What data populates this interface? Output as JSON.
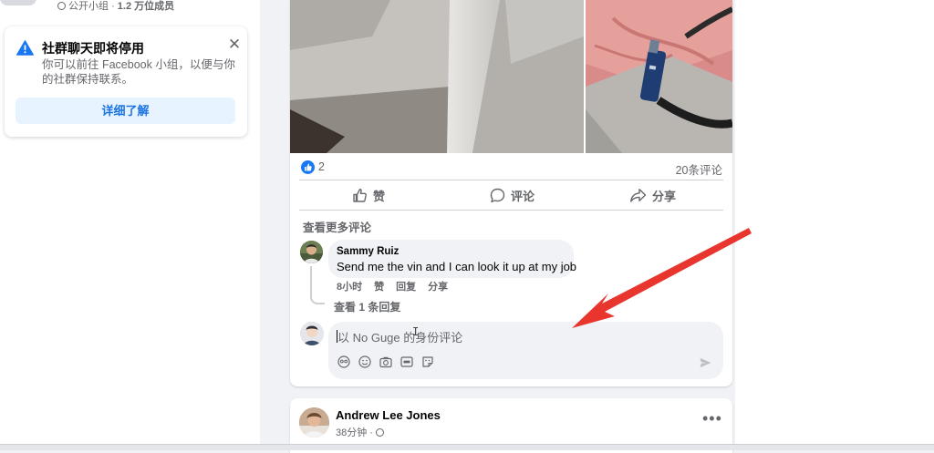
{
  "sidebar": {
    "group_meta_prefix": "公开小组 · ",
    "group_meta_count": "1.2 万位成员"
  },
  "notice": {
    "title": "社群聊天即将停用",
    "body": "你可以前往 Facebook 小组，以便与你的社群保持联系。",
    "close_glyph": "✕",
    "button_label": "详细了解"
  },
  "post": {
    "reaction_count": "2",
    "comment_count": "20条评论",
    "actions": {
      "like": "赞",
      "comment": "评论",
      "share": "分享"
    },
    "view_more_comments": "查看更多评论",
    "comment": {
      "author": "Sammy Ruiz",
      "text": "Send me the vin and I can look it up at my job",
      "time": "8小时",
      "like": "赞",
      "reply": "回复",
      "share": "分享"
    },
    "view_replies": "查看 1 条回复",
    "composer": {
      "placeholder": "以 No Guge 的身份评论",
      "tools": [
        "avatar-sticker-icon",
        "emoji-icon",
        "camera-icon",
        "gif-icon",
        "sticker-icon"
      ]
    }
  },
  "next_post": {
    "author": "Andrew Lee Jones",
    "time": "38分钟 · ",
    "more_glyph": "•••"
  },
  "colors": {
    "accent": "#1877f2",
    "arrow": "#e8362f",
    "secondary_text": "#65676b",
    "bubble_bg": "#f0f2f5"
  }
}
